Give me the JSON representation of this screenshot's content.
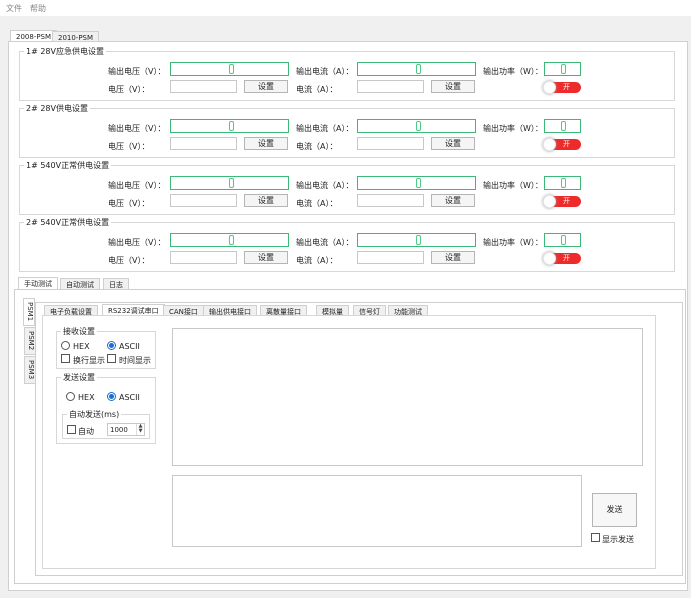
{
  "menu": {
    "file": "文件",
    "help": "帮助"
  },
  "top_tabs": [
    "2008-PSM",
    "2010-PSM"
  ],
  "groups": [
    {
      "title": "1# 28V应急供电设置",
      "switch": "开"
    },
    {
      "title": "2# 28V供电设置",
      "switch": "开"
    },
    {
      "title": "1# 540V正常供电设置",
      "switch": "开"
    },
    {
      "title": "2# 540V正常供电设置",
      "switch": "开"
    }
  ],
  "labels": {
    "out_voltage": "输出电压（V）：",
    "out_current": "输出电流（A）：",
    "out_power": "输出功率（W）：",
    "voltage": "电压（V）：",
    "current": "电流（A）：",
    "set": "设置"
  },
  "mode_tabs": [
    "手动测试",
    "自动测试",
    "日志"
  ],
  "psm_tabs": [
    "PSM1",
    "PSM2",
    "PSM3"
  ],
  "func_tabs": [
    "电子负载设置",
    "RS232调试串口",
    "CAN接口",
    "输出供电接口",
    "离散量接口",
    "模拟量",
    "信号灯",
    "功能测试"
  ],
  "receive": {
    "legend": "接收设置",
    "hex": "HEX",
    "ascii": "ASCII",
    "newline": "换行显示",
    "time": "时间显示"
  },
  "send": {
    "legend": "发送设置",
    "hex": "HEX",
    "ascii": "ASCII",
    "auto_legend": "自动发送(ms)",
    "auto": "自动",
    "interval": "1000",
    "button": "发送",
    "show_send": "显示发送"
  },
  "colors": {
    "lcd_border": "#3cb878",
    "switch_on": "#ee2b2b",
    "radio_selected": "#1a6fd0"
  }
}
